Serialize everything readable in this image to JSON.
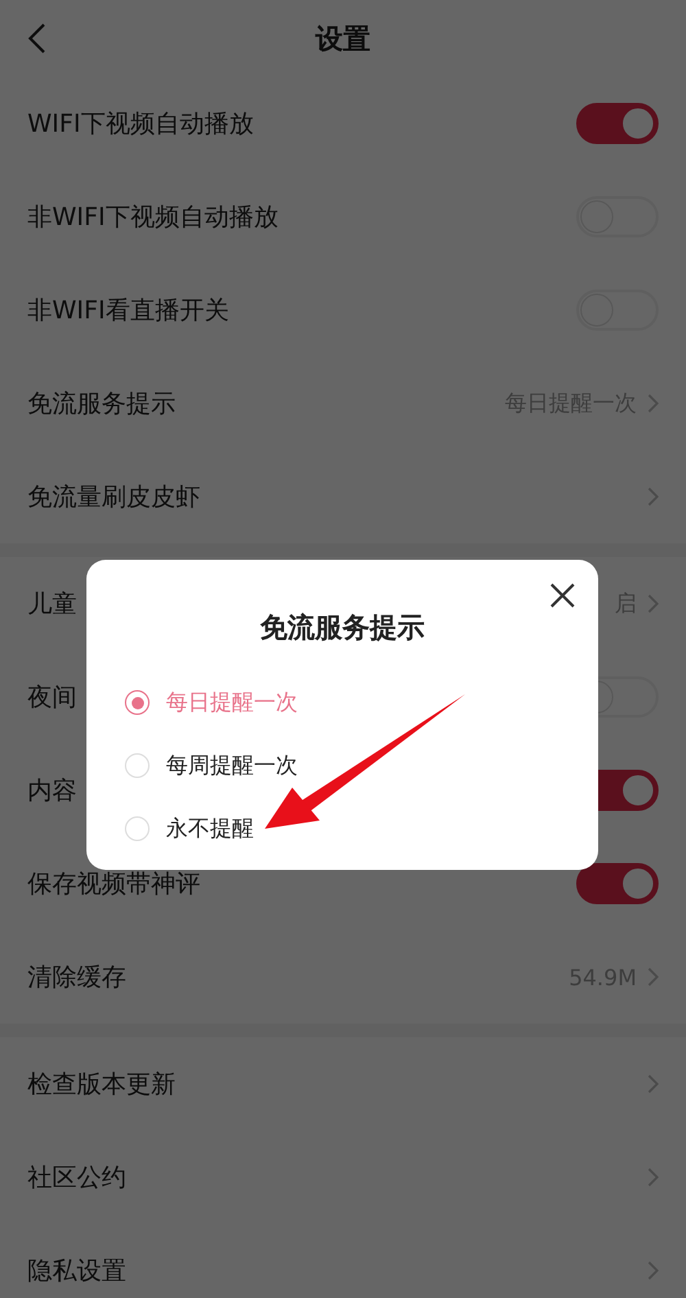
{
  "header": {
    "title": "设置"
  },
  "sections": [
    {
      "rows": [
        {
          "label": "WIFI下视频自动播放",
          "kind": "toggle",
          "on": true
        },
        {
          "label": "非WIFI下视频自动播放",
          "kind": "toggle",
          "on": false
        },
        {
          "label": "非WIFI看直播开关",
          "kind": "toggle",
          "on": false
        },
        {
          "label": "免流服务提示",
          "kind": "link",
          "value": "每日提醒一次"
        },
        {
          "label": "免流量刷皮皮虾",
          "kind": "link"
        }
      ]
    },
    {
      "rows": [
        {
          "label": "儿童",
          "kind": "link",
          "value": "启"
        },
        {
          "label": "夜间",
          "kind": "toggle",
          "on": false
        },
        {
          "label": "内容",
          "kind": "toggle",
          "on": true
        },
        {
          "label": "保存视频带神评",
          "kind": "toggle",
          "on": true
        },
        {
          "label": "清除缓存",
          "kind": "link",
          "value": "54.9M"
        }
      ]
    },
    {
      "rows": [
        {
          "label": "检查版本更新",
          "kind": "link"
        },
        {
          "label": "社区公约",
          "kind": "link"
        },
        {
          "label": "隐私设置",
          "kind": "link"
        }
      ]
    }
  ],
  "dialog": {
    "title": "免流服务提示",
    "options": [
      {
        "label": "每日提醒一次",
        "selected": true
      },
      {
        "label": "每周提醒一次",
        "selected": false
      },
      {
        "label": "永不提醒",
        "selected": false
      }
    ]
  }
}
